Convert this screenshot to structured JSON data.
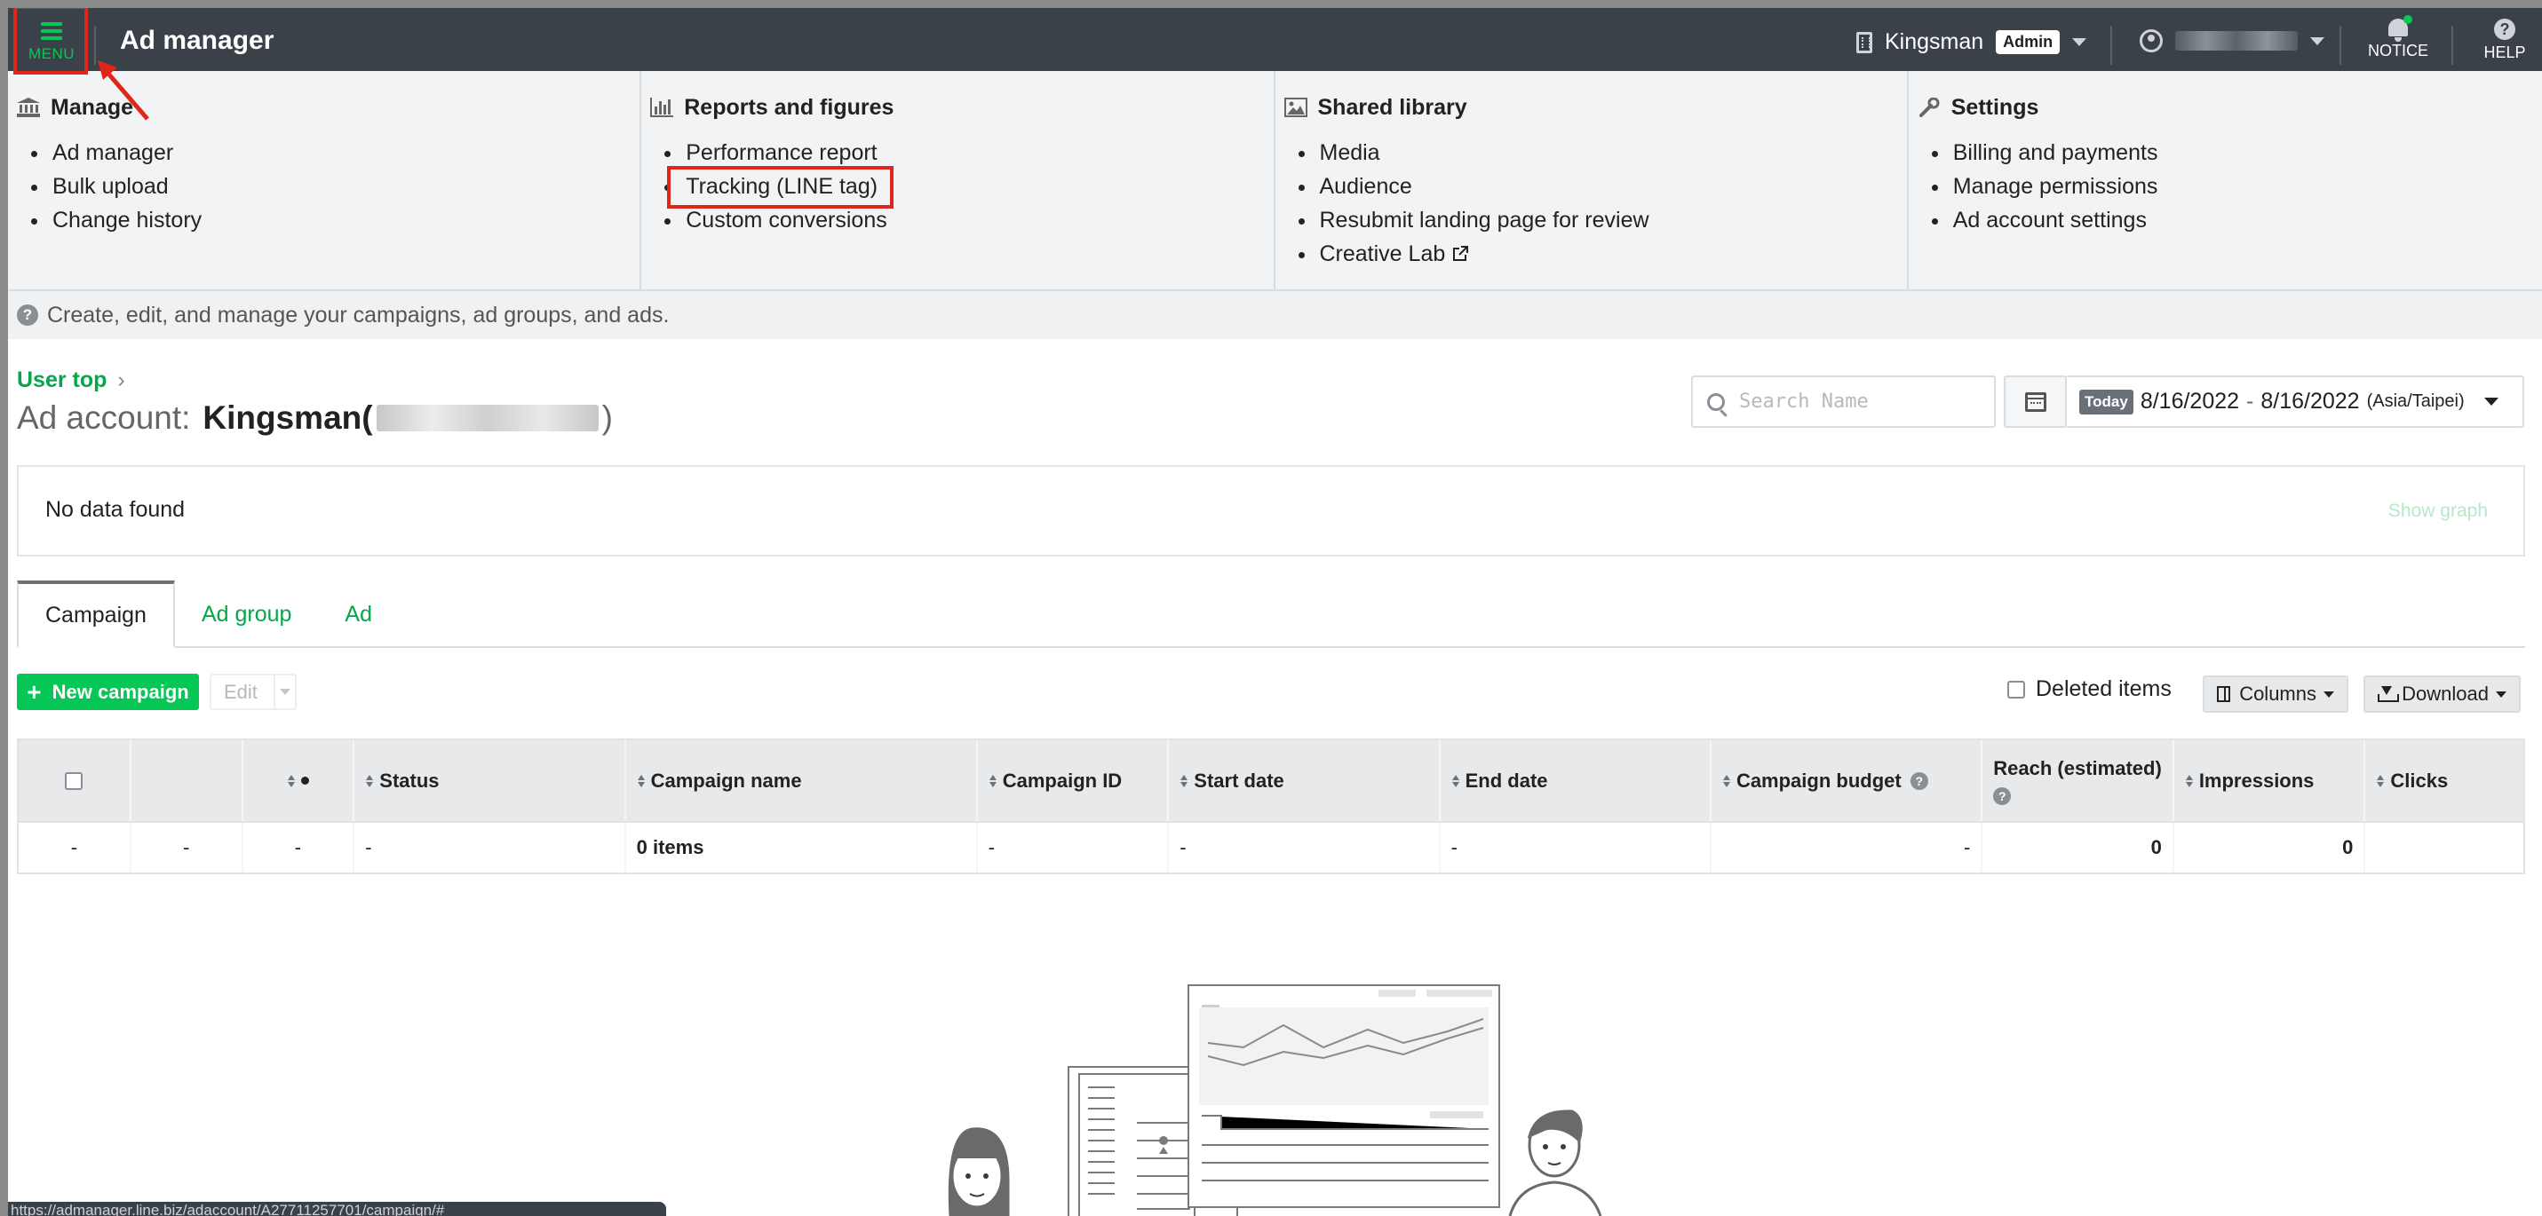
{
  "header": {
    "menu_label": "MENU",
    "title": "Ad manager",
    "account_name": "Kingsman",
    "role_badge": "Admin",
    "notice_label": "NOTICE",
    "help_label": "HELP",
    "help_glyph": "?",
    "brand_color": "#06c755",
    "header_bg": "#3b4148"
  },
  "megamenu": {
    "manage": {
      "title": "Manage",
      "icon": "bank-icon",
      "items": [
        "Ad manager",
        "Bulk upload",
        "Change history"
      ]
    },
    "reports": {
      "title": "Reports and figures",
      "icon": "bar-chart-icon",
      "items": [
        "Performance report",
        "Tracking (LINE tag)",
        "Custom conversions"
      ]
    },
    "library": {
      "title": "Shared library",
      "icon": "image-icon",
      "items": [
        "Media",
        "Audience",
        "Resubmit landing page for review",
        "Creative Lab"
      ]
    },
    "settings": {
      "title": "Settings",
      "icon": "wrench-icon",
      "items": [
        "Billing and payments",
        "Manage permissions",
        "Ad account settings"
      ]
    }
  },
  "infobar": {
    "glyph": "?",
    "text": "Create, edit, and manage your campaigns, ad groups, and ads."
  },
  "account": {
    "breadcrumb": "User top",
    "breadcrumb_chevron": "›",
    "label": "Ad account:",
    "name": "Kingsman(",
    "close_paren": ")"
  },
  "search": {
    "placeholder": "Search Name"
  },
  "date": {
    "today_badge": "Today",
    "start": "8/16/2022",
    "separator": "-",
    "end": "8/16/2022",
    "timezone": "(Asia/Taipei)"
  },
  "summary": {
    "message": "No data found",
    "show_graph": "Show graph"
  },
  "tabs": [
    "Campaign",
    "Ad group",
    "Ad"
  ],
  "toolbar": {
    "new_campaign": "New campaign",
    "new_glyph": "+",
    "edit": "Edit",
    "deleted_items": "Deleted items",
    "columns": "Columns",
    "download": "Download"
  },
  "table": {
    "headers": [
      "",
      "",
      "",
      "Status",
      "Campaign name",
      "Campaign ID",
      "Start date",
      "End date",
      "Campaign budget",
      "Reach (estimated)",
      "Impressions",
      "Clicks"
    ],
    "row": [
      "-",
      "-",
      "-",
      "-",
      "0 items",
      "-",
      "-",
      "-",
      "-",
      "0",
      "0",
      ""
    ]
  },
  "status_bar": {
    "url": "https://admanager.line.biz/adaccount/A27711257701/campaign/#"
  }
}
